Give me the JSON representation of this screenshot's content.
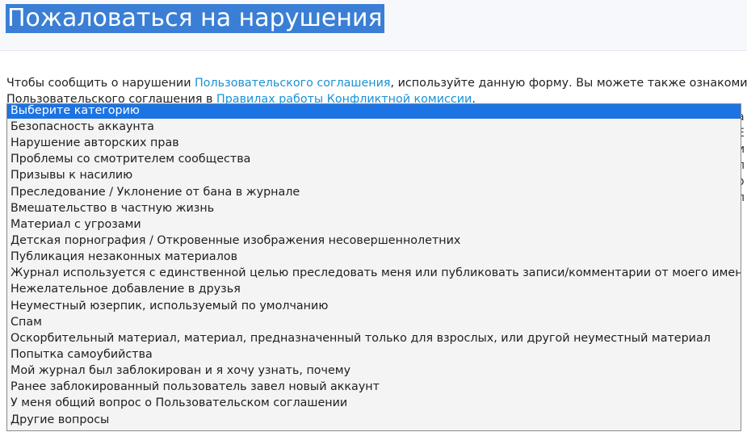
{
  "header": {
    "title": "Пожаловаться на нарушения"
  },
  "intro": {
    "text_before": "Чтобы сообщить о нарушении ",
    "link_terms": "Пользовательского соглашения",
    "text_after": ", используйте данную форму. Вы можете также ознакомиться",
    "line2_before": "Пользовательского соглашения в ",
    "link_rules": "Правилах работы Конфликтной комиссии",
    "line2_after": "."
  },
  "background_fragments": [
    "а",
    "Е",
    "и",
    "л",
    "о",
    "л"
  ],
  "category_select": {
    "selected_index": 0,
    "options": [
      "Выберите категорию",
      "Безопасность аккаунта",
      "Нарушение авторских прав",
      "Проблемы со смотрителем сообщества",
      "Призывы к насилию",
      "Преследование / Уклонение от бана в журнале",
      "Вмешательство в частную жизнь",
      "Материал с угрозами",
      "Детская порнография / Откровенные изображения несовершеннолетних",
      "Публикация незаконных материалов",
      "Журнал используется с единственной целью преследовать меня или публиковать записи/комментарии от моего имени",
      "Нежелательное добавление в друзья",
      "Неуместный юзерпик, используемый по умолчанию",
      "Спам",
      "Оскорбительный материал, материал, предназначенный только для взрослых, или другой неуместный материал",
      "Попытка самоубийства",
      "Мой журнал был заблокирован и я хочу узнать, почему",
      "Ранее заблокированный пользователь завел новый аккаунт",
      "У меня общий вопрос о Пользовательском соглашении",
      "Другие вопросы"
    ]
  },
  "colors": {
    "title_highlight": "#3a7fd5",
    "link": "#1a91d4",
    "option_selected": "#1c73e3"
  }
}
